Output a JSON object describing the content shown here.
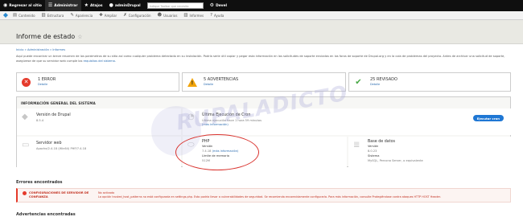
{
  "toolbar": {
    "items": [
      {
        "icon": "drupal-drop-icon",
        "glyph": "◉",
        "label": "Regresar al sitio"
      },
      {
        "icon": "menu-icon",
        "glyph": "☰",
        "label": "Administrar"
      },
      {
        "icon": "star-icon",
        "glyph": "★",
        "label": "Atajos"
      },
      {
        "icon": "user-icon",
        "glyph": "●",
        "label": "adminDrupal"
      }
    ],
    "search_placeholder": "Indique Toolbar que necesita",
    "devel": {
      "icon": "gear-icon",
      "glyph": "⚙",
      "label": "Devel"
    }
  },
  "tray": {
    "items": [
      {
        "icon": "content-icon",
        "glyph": "▤",
        "label": "Contenido"
      },
      {
        "icon": "structure-icon",
        "glyph": "▥",
        "label": "Estructura"
      },
      {
        "icon": "appearance-icon",
        "glyph": "✎",
        "label": "Apariencia"
      },
      {
        "icon": "extend-icon",
        "glyph": "✚",
        "label": "Ampliar"
      },
      {
        "icon": "config-icon",
        "glyph": "✗",
        "label": "Configuración"
      },
      {
        "icon": "people-icon",
        "glyph": "☻",
        "label": "Usuarios"
      },
      {
        "icon": "reports-icon",
        "glyph": "▥",
        "label": "Informes"
      },
      {
        "icon": "help-icon",
        "glyph": "?",
        "label": "Ayuda"
      }
    ]
  },
  "page": {
    "title": "Informe de estado",
    "breadcrumb": "Inicio » Administración » Informes",
    "intro": "Aquí puede encontrar un breve resumen de los parámetros de su sitio así como cualquier problema detectado en su instalación. Podría serle útil copiar y pegar esta información en las solicitudes de soporte enviadas en los foros de soporte de Drupal.org y en la cola de problemas del proyecto. Antes de archivar una solicitud de soporte, asegúrese de que su servidor web cumple los",
    "intro_link": "requisitos del sistema."
  },
  "summary": [
    {
      "type": "error",
      "count": "1 ERROR",
      "link": "Detalle"
    },
    {
      "type": "warning",
      "count": "5 ADVERTENCIAS",
      "link": "Detalle"
    },
    {
      "type": "ok",
      "count": "25 REVISADO",
      "link": "Detalle"
    }
  ],
  "info": {
    "title": "INFORMACIÓN GENERAL DEL SISTEMA",
    "drupal": {
      "label": "Versión de Drupal",
      "value": "8.5.4"
    },
    "cron": {
      "label": "Última Ejecución de Cron",
      "value": "Última ejecución hace 1 hora 59 minutos",
      "link": "(más información)",
      "button": "Ejecutar cron"
    },
    "web": {
      "label": "Servidor web",
      "value": "Apache/2.4.18 (Win64) PHP/7.4.18"
    },
    "php": {
      "label": "PHP",
      "version_label": "Versión",
      "version_value": "7.4.18",
      "version_link": "(más información)",
      "memory_label": "Límite de memoria",
      "memory_value": "512M"
    },
    "db": {
      "label": "Base de datos",
      "version_label": "Versión",
      "version_value": "8.0.23",
      "system_label": "Sistema",
      "system_value": "MySQL, Percona Server, o equivalente"
    }
  },
  "errors": {
    "title": "Errores encontrados",
    "item": {
      "label": "CONFIGURACIONES DE SERVIDOR DE CONFIANZA",
      "status": "No activado",
      "description": "La opción trusted_host_patterns no está configurada en settings.php. Esto podría llevar a vulnerabilidades de seguridad. Se recomienda encarecidamente configurarla. Para más información, consulte Protegiéndose contra ataques HTTP HOST Header."
    }
  },
  "warnings_title": "Advertencias encontradas",
  "watermark": "RUPALADICTO",
  "colors": {
    "accent": "#1f77d4",
    "error": "#e53a2b",
    "warning": "#f1a40b",
    "ok": "#47a844",
    "annotation": "#d9312c"
  }
}
